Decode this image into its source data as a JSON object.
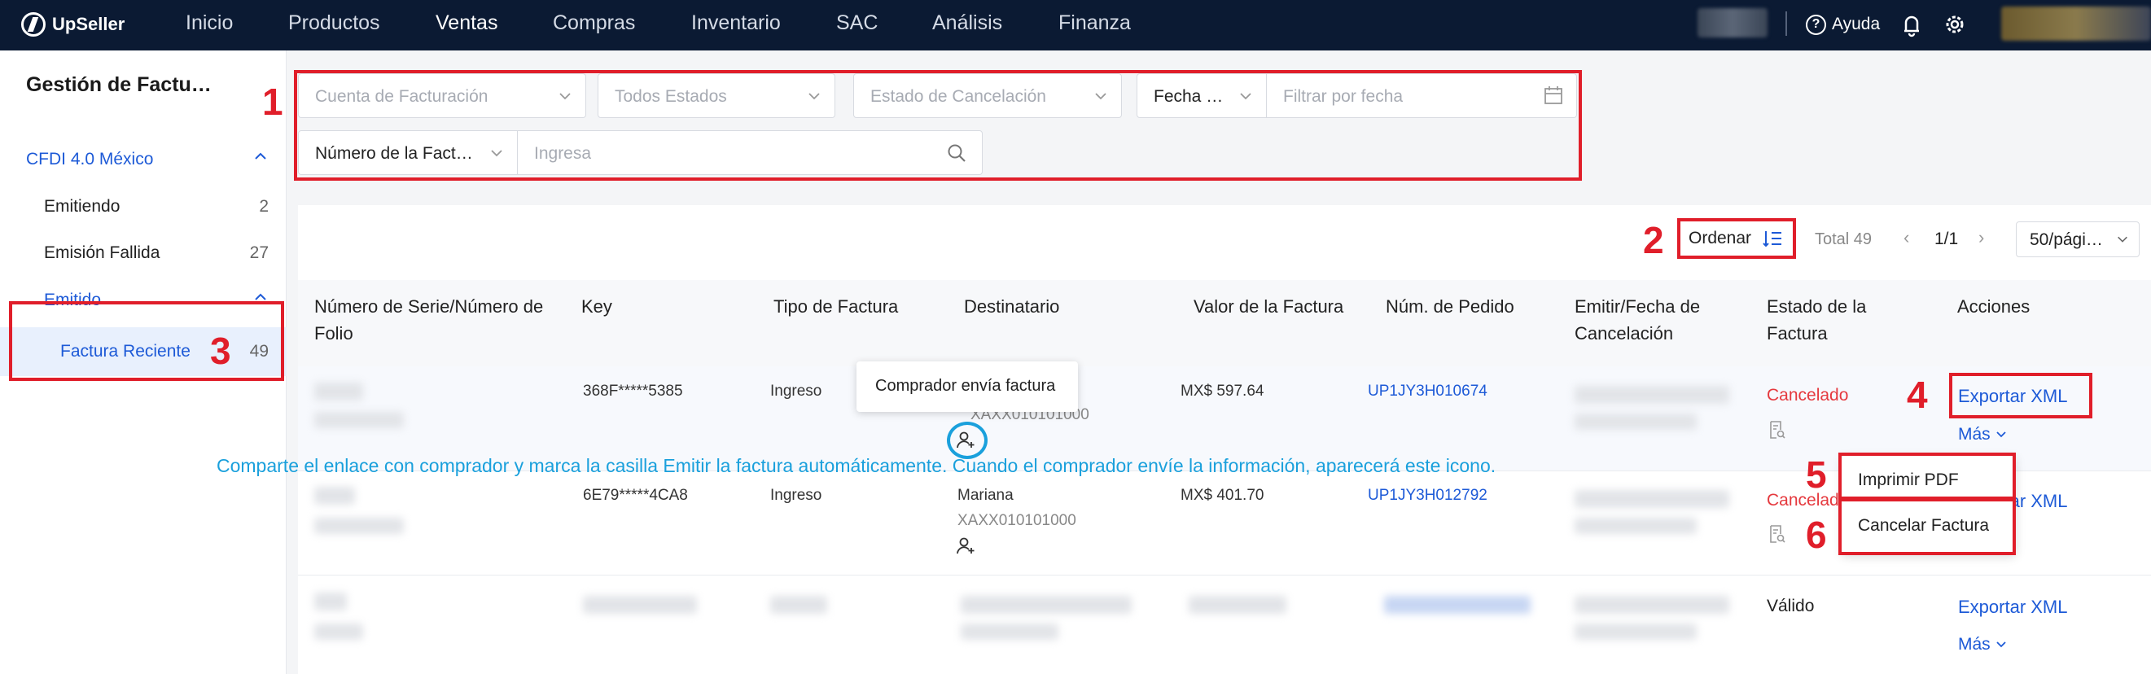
{
  "topnav": {
    "brand": "UpSeller",
    "items": [
      "Inicio",
      "Productos",
      "Ventas",
      "Compras",
      "Inventario",
      "SAC",
      "Análisis",
      "Finanza"
    ],
    "active": "Ventas",
    "help_label": "Ayuda"
  },
  "sidebar": {
    "title": "Gestión de Factu…",
    "group": "CFDI 4.0 México",
    "items": [
      {
        "label": "Emitiendo",
        "count": "2"
      },
      {
        "label": "Emisión Fallida",
        "count": "27"
      },
      {
        "label": "Emitido",
        "count": ""
      },
      {
        "label": "Factura Reciente",
        "count": "49"
      }
    ]
  },
  "filters": {
    "account_placeholder": "Cuenta de Facturación",
    "status_placeholder": "Todos Estados",
    "cancel_placeholder": "Estado de Cancelación",
    "date_type": "Fecha …",
    "date_placeholder": "Filtrar por fecha",
    "search_type": "Número de la Fact…",
    "search_placeholder": "Ingresa"
  },
  "toolbar": {
    "sort_label": "Ordenar",
    "total": "Total 49",
    "page": "1/1",
    "per_page": "50/pági…"
  },
  "table": {
    "headers": [
      "Número de Serie/Número de Folio",
      "Key",
      "Tipo de Factura",
      "Destinatario",
      "Valor de la Factura",
      "Núm. de Pedido",
      "Emitir/Fecha de Cancelación",
      "Estado de la Factura",
      "Acciones"
    ],
    "rows": [
      {
        "key": "368F*****5385",
        "type": "Ingreso",
        "recipient_rfc": "XAXX010101000",
        "amount": "MX$ 597.64",
        "order": "UP1JY3H010674",
        "status": "Cancelado",
        "action": "Exportar XML",
        "more": "Más"
      },
      {
        "key": "6E79*****4CA8",
        "type": "Ingreso",
        "recipient_name": "Mariana",
        "recipient_rfc": "XAXX010101000",
        "amount": "MX$ 401.70",
        "order": "UP1JY3H012792",
        "status": "Cancelado",
        "action": "Exportar XML"
      },
      {
        "status": "Válido",
        "action": "Exportar XML",
        "more": "Más"
      }
    ]
  },
  "popover": {
    "text": "Comprador envía factura"
  },
  "more_menu": {
    "print_pdf": "Imprimir PDF",
    "cancel_invoice": "Cancelar Factura"
  },
  "annotations": {
    "numbers": [
      "1",
      "2",
      "3",
      "4",
      "5",
      "6"
    ],
    "note": "Comparte el enlace con comprador y marca la casilla Emitir la factura automáticamente. Cuando el comprador envíe la información, aparecerá este icono."
  },
  "colors": {
    "nav_bg": "#0b1a33",
    "accent": "#1d5ad7",
    "annotation": "#e01e2a",
    "note": "#1aa0dc",
    "cancel": "#e5393e"
  }
}
